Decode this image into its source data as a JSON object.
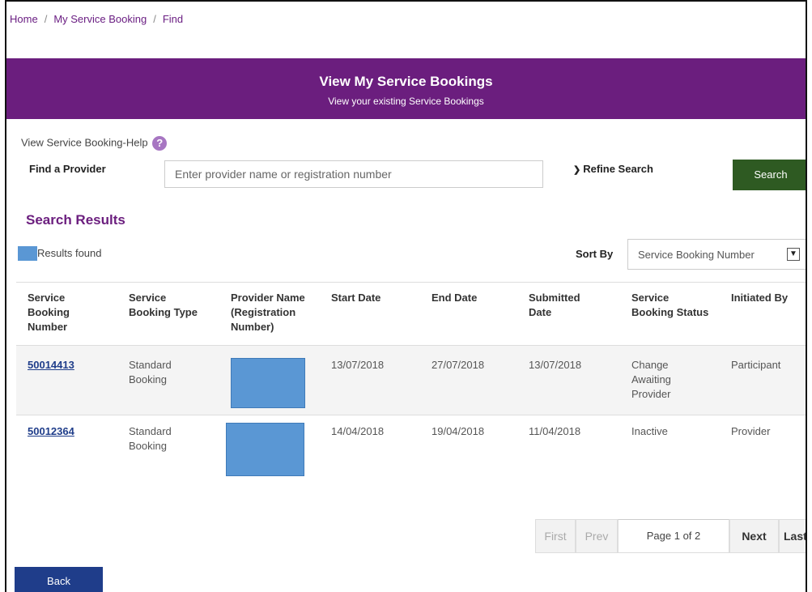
{
  "breadcrumb": {
    "home": "Home",
    "sep": "/",
    "section": "My Service Booking",
    "current": "Find"
  },
  "banner": {
    "title": "View My Service Bookings",
    "subtitle": "View your existing Service Bookings"
  },
  "help": {
    "label": "View Service Booking-Help",
    "icon": "?"
  },
  "find": {
    "label": "Find a Provider",
    "placeholder": "Enter provider name or registration number",
    "value": ""
  },
  "refine": {
    "icon": "chevron-down-icon",
    "label": "Refine Search"
  },
  "search_button": "Search",
  "results": {
    "title": "Search Results",
    "found_label": "Results found"
  },
  "sort": {
    "label": "Sort By",
    "selected": "Service Booking Number"
  },
  "table": {
    "headers": [
      [
        "Service",
        "Booking",
        "Number"
      ],
      [
        "Service",
        "Booking Type"
      ],
      [
        "Provider Name",
        "(Registration",
        "Number)"
      ],
      [
        "Start Date"
      ],
      [
        "End Date"
      ],
      [
        "Submitted",
        "Date"
      ],
      [
        "Service",
        "Booking Status"
      ],
      [
        "Initiated By"
      ]
    ],
    "rows": [
      {
        "number": "50014413",
        "type": [
          "Standard",
          "Booking"
        ],
        "start": "13/07/2018",
        "end": "27/07/2018",
        "submitted": "13/07/2018",
        "status": [
          "Change",
          "Awaiting",
          "Provider"
        ],
        "initiated_by": "Participant"
      },
      {
        "number": "50012364",
        "type": [
          "Standard",
          "Booking"
        ],
        "start": "14/04/2018",
        "end": "19/04/2018",
        "submitted": "11/04/2018",
        "status": [
          "Inactive"
        ],
        "initiated_by": "Provider"
      }
    ]
  },
  "pagination": {
    "first": "First",
    "prev": "Prev",
    "page": "Page 1 of 2",
    "next": "Next",
    "last": "Last"
  },
  "back_button": "Back",
  "colors": {
    "brand_purple": "#6b1e7e",
    "search_green": "#2e5a22",
    "back_blue": "#1f3d8a",
    "redaction_blue": "#5a97d4"
  }
}
